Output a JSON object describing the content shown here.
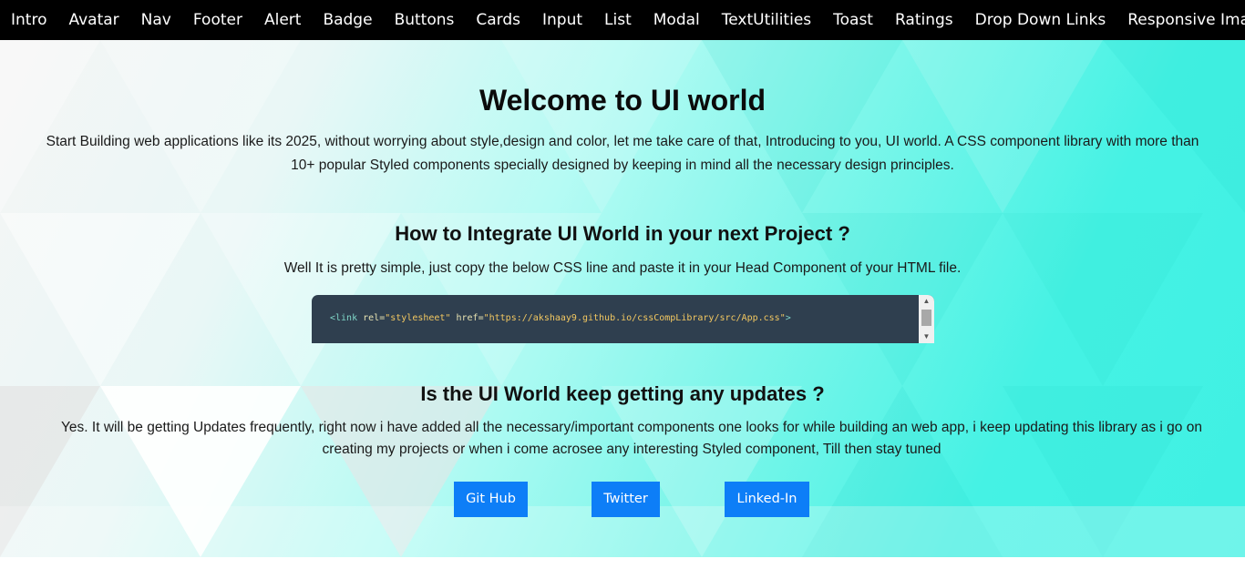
{
  "nav": {
    "items": [
      "Intro",
      "Avatar",
      "Nav",
      "Footer",
      "Alert",
      "Badge",
      "Buttons",
      "Cards",
      "Input",
      "List",
      "Modal",
      "TextUtilities",
      "Toast",
      "Ratings",
      "Drop Down Links",
      "Responsive Image"
    ]
  },
  "hero": {
    "title": "Welcome to UI world",
    "intro": "Start Building web applications like its 2025, without worrying about style,design and color, let me take care of that, Introducing to you, UI world. A CSS component library with more than 10+ popular Styled components specially designed by keeping in mind all the necessary design principles."
  },
  "integrate": {
    "heading": "How to Integrate UI World in your next Project ?",
    "text": "Well It is pretty simple, just copy the below CSS line and paste it in your Head Component of your HTML file.",
    "code": {
      "tag_open": "<link",
      "attr1": " rel=",
      "val1": "\"stylesheet\"",
      "attr2": " href=",
      "val2": "\"https://akshaay9.github.io/cssCompLibrary/src/App.css\"",
      "tag_close": ">"
    }
  },
  "updates": {
    "heading": "Is the UI World keep getting any updates ?",
    "text": "Yes. It will be getting Updates frequently, right now i have added all the necessary/important components one looks for while building an web app, i keep updating this library as i go on creating my projects or when i come acrosee any interesting Styled component, Till then stay tuned"
  },
  "buttons": {
    "github": "Git Hub",
    "twitter": "Twitter",
    "linkedin": "Linked-In"
  },
  "colors": {
    "nav_bg": "#000000",
    "button_bg": "#0d7ef7",
    "code_bg": "#2f3f4f",
    "accent_teal": "#3ff0e3"
  }
}
